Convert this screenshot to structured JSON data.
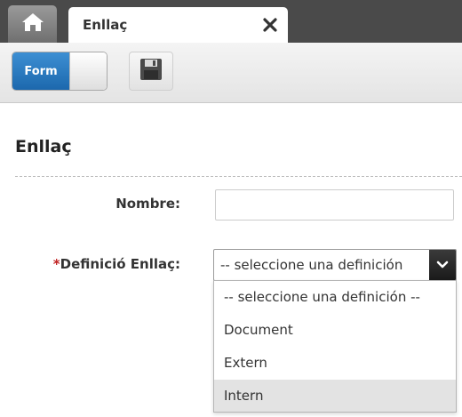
{
  "tabs": {
    "home_icon": "home-icon",
    "active_label": "Enllaç",
    "close_icon": "close-icon"
  },
  "toolbar": {
    "toggle_label": "Form",
    "toggle_state": "on",
    "save_icon": "floppy-disk-icon"
  },
  "form": {
    "section_title": "Enllaç",
    "fields": {
      "nombre": {
        "label": "Nombre:",
        "value": "",
        "placeholder": ""
      },
      "definicio": {
        "required_marker": "*",
        "label": "Definició Enllaç:",
        "selected": "-- seleccione una definición --",
        "options": [
          "-- seleccione una definición --",
          "Document",
          "Extern",
          "Intern"
        ],
        "highlighted_option": "Intern"
      }
    }
  },
  "colors": {
    "tabbar": "#4a4a4a",
    "toggle_accent": "#1c68ad",
    "required": "#c02020",
    "option_highlight": "#e3e3e3"
  }
}
